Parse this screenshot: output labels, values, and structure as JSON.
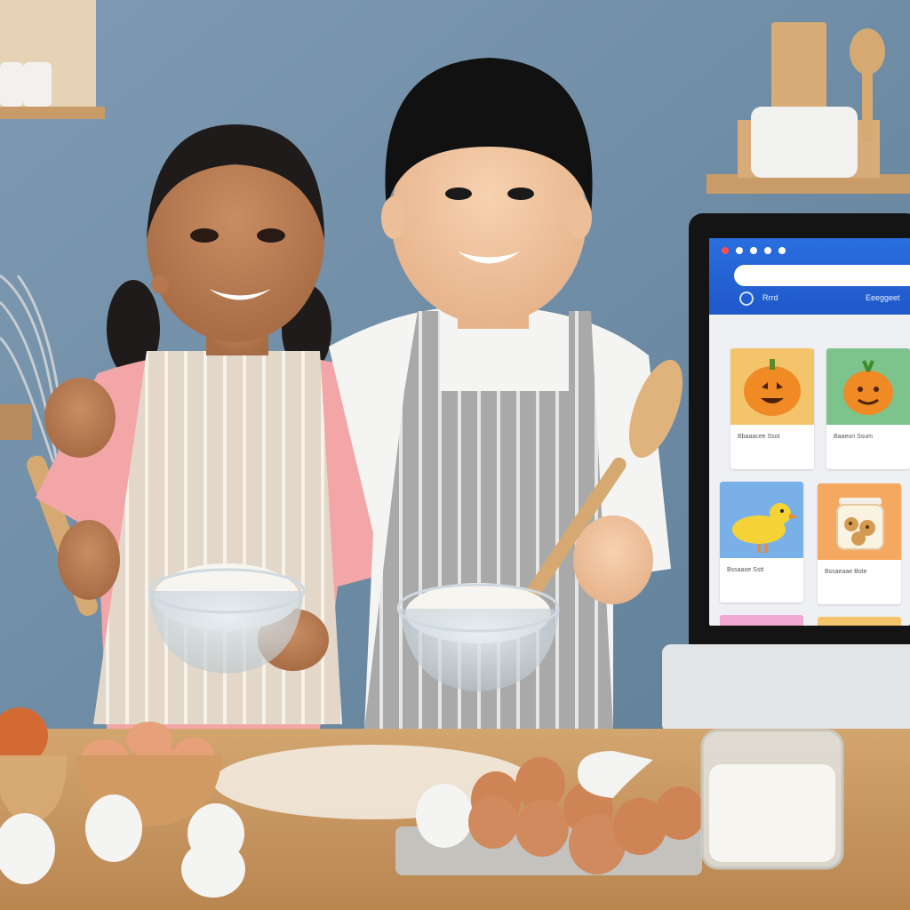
{
  "photo": {
    "subject": "two children baking",
    "colors": {
      "wall": "#6f8ea6",
      "counter": "#c99862",
      "girl_shirt": "#f3a6a8",
      "boy_shirt": "#f4f4f2",
      "apron_beige": "#e2d7c8",
      "apron_gray": "#a9a9aa",
      "egg_brown": "#c97a4b",
      "egg_white": "#f4f4f2",
      "flour": "#f7f5ef",
      "wood": "#d6a972"
    }
  },
  "screen": {
    "tabs": [
      {
        "label": "Rrrd"
      },
      {
        "label": "Eeeggeet"
      }
    ],
    "cards": [
      {
        "icon": "pumpkin-icon",
        "caption": "Bbaaacee Ssot",
        "color": "#f4c46a"
      },
      {
        "icon": "pumpkin-icon",
        "caption": "Baaeon Ssum",
        "color": "#7cc48c"
      },
      {
        "icon": "chick-icon",
        "caption": "Bssaaoe Sstt",
        "color": "#7ab0e8"
      },
      {
        "icon": "cookie-jar-icon",
        "caption": "Bssaeaae Bote",
        "color": "#f4a860"
      }
    ]
  }
}
